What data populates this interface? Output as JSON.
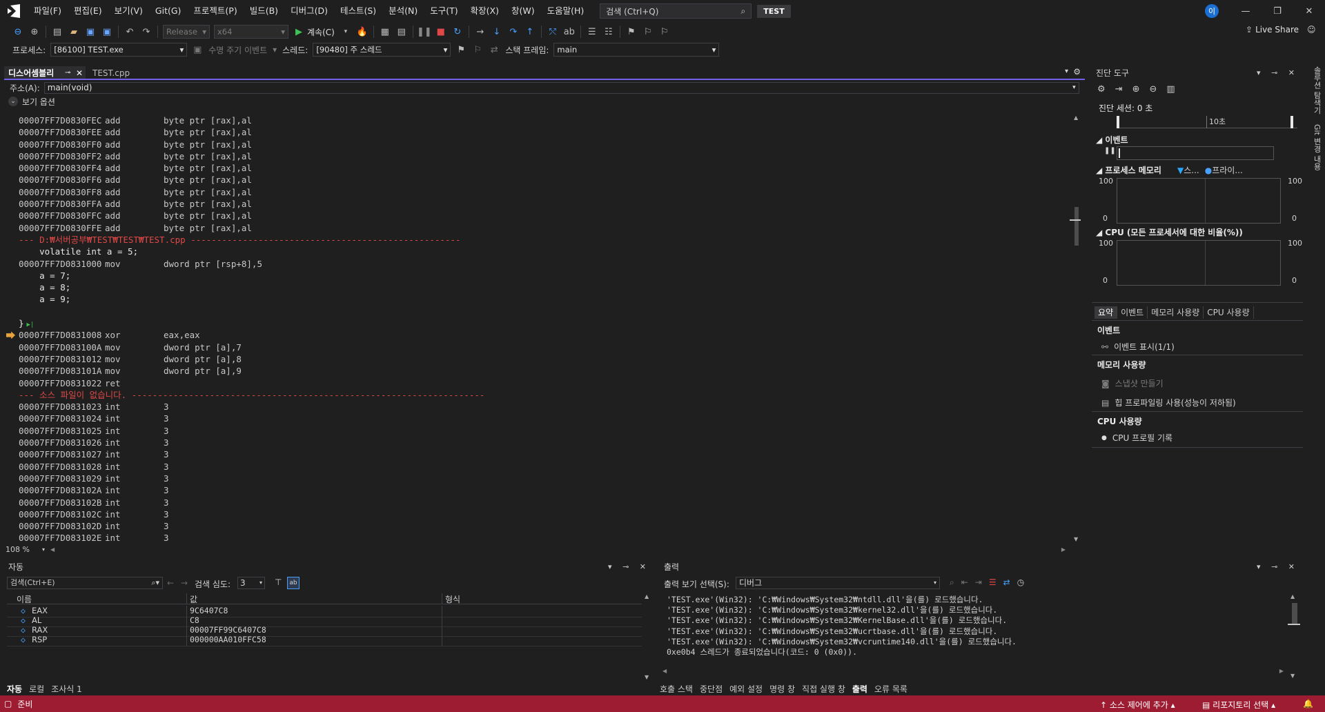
{
  "menu": {
    "items": [
      "파일(F)",
      "편집(E)",
      "보기(V)",
      "Git(G)",
      "프로젝트(P)",
      "빌드(B)",
      "디버그(D)",
      "테스트(S)",
      "분석(N)",
      "도구(T)",
      "확장(X)",
      "창(W)",
      "도움말(H)"
    ],
    "search_placeholder": "검색 (Ctrl+Q)",
    "solution_name": "TEST",
    "avatar": "이"
  },
  "toolbar1": {
    "config": "Release",
    "platform": "x64",
    "continue_label": "계속(C)",
    "live_share": "Live Share"
  },
  "toolbar2": {
    "process_label": "프로세스:",
    "process_value": "[86100] TEST.exe",
    "lifecycle_label": "수명 주기 이벤트",
    "thread_label": "스레드:",
    "thread_value": "[90480] 주 스레드",
    "stackframe_label": "스택 프레임:",
    "stackframe_value": "main"
  },
  "editor": {
    "tabs": [
      "디스어셈블리",
      "TEST.cpp"
    ],
    "address_label": "주소(A):",
    "address_value": "main(void)",
    "view_options": "보기 옵션",
    "zoom": "108 %",
    "lines": [
      {
        "t": "asm",
        "a": "00007FF7D0830FEC",
        "m": "add",
        "o": "byte ptr [rax],al"
      },
      {
        "t": "asm",
        "a": "00007FF7D0830FEE",
        "m": "add",
        "o": "byte ptr [rax],al"
      },
      {
        "t": "asm",
        "a": "00007FF7D0830FF0",
        "m": "add",
        "o": "byte ptr [rax],al"
      },
      {
        "t": "asm",
        "a": "00007FF7D0830FF2",
        "m": "add",
        "o": "byte ptr [rax],al"
      },
      {
        "t": "asm",
        "a": "00007FF7D0830FF4",
        "m": "add",
        "o": "byte ptr [rax],al"
      },
      {
        "t": "asm",
        "a": "00007FF7D0830FF6",
        "m": "add",
        "o": "byte ptr [rax],al"
      },
      {
        "t": "asm",
        "a": "00007FF7D0830FF8",
        "m": "add",
        "o": "byte ptr [rax],al"
      },
      {
        "t": "asm",
        "a": "00007FF7D0830FFA",
        "m": "add",
        "o": "byte ptr [rax],al"
      },
      {
        "t": "asm",
        "a": "00007FF7D0830FFC",
        "m": "add",
        "o": "byte ptr [rax],al"
      },
      {
        "t": "asm",
        "a": "00007FF7D0830FFE",
        "m": "add",
        "o": "byte ptr [rax],al"
      },
      {
        "t": "sep",
        "s": "--- D:₩서버공부₩TEST₩TEST₩TEST.cpp ----------------------------------------------------"
      },
      {
        "t": "src",
        "s": "    volatile int a = 5;"
      },
      {
        "t": "asm",
        "a": "00007FF7D0831000",
        "m": "mov",
        "o": "dword ptr [rsp+8],5"
      },
      {
        "t": "src",
        "s": "    a = 7;"
      },
      {
        "t": "src",
        "s": "    a = 8;"
      },
      {
        "t": "src",
        "s": "    a = 9;"
      },
      {
        "t": "src",
        "s": ""
      },
      {
        "t": "src",
        "s": "}"
      },
      {
        "t": "asm",
        "a": "00007FF7D0831008",
        "m": "xor",
        "o": "eax,eax",
        "cur": true
      },
      {
        "t": "asm",
        "a": "00007FF7D083100A",
        "m": "mov",
        "o": "dword ptr [a],7"
      },
      {
        "t": "asm",
        "a": "00007FF7D0831012",
        "m": "mov",
        "o": "dword ptr [a],8"
      },
      {
        "t": "asm",
        "a": "00007FF7D083101A",
        "m": "mov",
        "o": "dword ptr [a],9"
      },
      {
        "t": "asm",
        "a": "00007FF7D0831022",
        "m": "ret",
        "o": ""
      },
      {
        "t": "sep",
        "s": "--- 소스 파일이 없습니다. --------------------------------------------------------------------"
      },
      {
        "t": "asm",
        "a": "00007FF7D0831023",
        "m": "int",
        "o": "3"
      },
      {
        "t": "asm",
        "a": "00007FF7D0831024",
        "m": "int",
        "o": "3"
      },
      {
        "t": "asm",
        "a": "00007FF7D0831025",
        "m": "int",
        "o": "3"
      },
      {
        "t": "asm",
        "a": "00007FF7D0831026",
        "m": "int",
        "o": "3"
      },
      {
        "t": "asm",
        "a": "00007FF7D0831027",
        "m": "int",
        "o": "3"
      },
      {
        "t": "asm",
        "a": "00007FF7D0831028",
        "m": "int",
        "o": "3"
      },
      {
        "t": "asm",
        "a": "00007FF7D0831029",
        "m": "int",
        "o": "3"
      },
      {
        "t": "asm",
        "a": "00007FF7D083102A",
        "m": "int",
        "o": "3"
      },
      {
        "t": "asm",
        "a": "00007FF7D083102B",
        "m": "int",
        "o": "3"
      },
      {
        "t": "asm",
        "a": "00007FF7D083102C",
        "m": "int",
        "o": "3"
      },
      {
        "t": "asm",
        "a": "00007FF7D083102D",
        "m": "int",
        "o": "3"
      },
      {
        "t": "asm",
        "a": "00007FF7D083102E",
        "m": "int",
        "o": "3"
      }
    ]
  },
  "diag": {
    "title": "진단 도구",
    "session": "진단 세션: 0 초",
    "timeline_tick": "10초",
    "events_header": "이벤트",
    "memory_header": "프로세스 메모리",
    "memory_legend1": "스...",
    "memory_legend2": "프라이...",
    "cpu_header": "CPU (모든 프로세서에 대한 비율(%))",
    "axis_max": "100",
    "axis_min": "0",
    "tabs": [
      "요약",
      "이벤트",
      "메모리 사용량",
      "CPU 사용량"
    ],
    "sum_events": "이벤트",
    "sum_events_item": "이벤트 표시(1/1)",
    "sum_memory": "메모리 사용량",
    "sum_memory_item1": "스냅샷 만들기",
    "sum_memory_item2": "힙 프로파일링 사용(성능이 저하됨)",
    "sum_cpu": "CPU 사용량",
    "sum_cpu_item": "CPU 프로필 기록"
  },
  "autos": {
    "title": "자동",
    "search_placeholder": "검색(Ctrl+E)",
    "depth_label": "검색 심도:",
    "depth_value": "3",
    "col_name": "이름",
    "col_value": "값",
    "col_type": "형식",
    "rows": [
      {
        "name": "EAX",
        "value": "9C6407C8"
      },
      {
        "name": "AL",
        "value": "C8"
      },
      {
        "name": "RAX",
        "value": "00007FF99C6407C8"
      },
      {
        "name": "RSP",
        "value": "000000AA010FFC58"
      }
    ],
    "tabs": [
      "자동",
      "로컬",
      "조사식 1"
    ]
  },
  "output": {
    "title": "출력",
    "source_label": "출력 보기 선택(S):",
    "source_value": "디버그",
    "lines": [
      "'TEST.exe'(Win32): 'C:₩Windows₩System32₩ntdll.dll'을(를) 로드했습니다.",
      "'TEST.exe'(Win32): 'C:₩Windows₩System32₩kernel32.dll'을(를) 로드했습니다.",
      "'TEST.exe'(Win32): 'C:₩Windows₩System32₩KernelBase.dll'을(를) 로드했습니다.",
      "'TEST.exe'(Win32): 'C:₩Windows₩System32₩ucrtbase.dll'을(를) 로드했습니다.",
      "'TEST.exe'(Win32): 'C:₩Windows₩System32₩vcruntime140.dll'을(를) 로드했습니다.",
      "0xe0b4 스레드가 종료되었습니다(코드: 0 (0x0))."
    ],
    "tabs": [
      "호출 스택",
      "중단점",
      "예외 설정",
      "명령 창",
      "직접 실행 창",
      "출력",
      "오류 목록"
    ]
  },
  "rail": [
    "솔루션 탐색기",
    "Git 변경 내용"
  ],
  "status": {
    "ready": "준비",
    "source_control": "소스 제어에 추가",
    "repository": "리포지토리 선택"
  },
  "colors": {
    "accent": "#7160e8",
    "status": "#9e1c32",
    "breakpoint_arrow": "#e8a23c",
    "separator": "#e04848"
  }
}
